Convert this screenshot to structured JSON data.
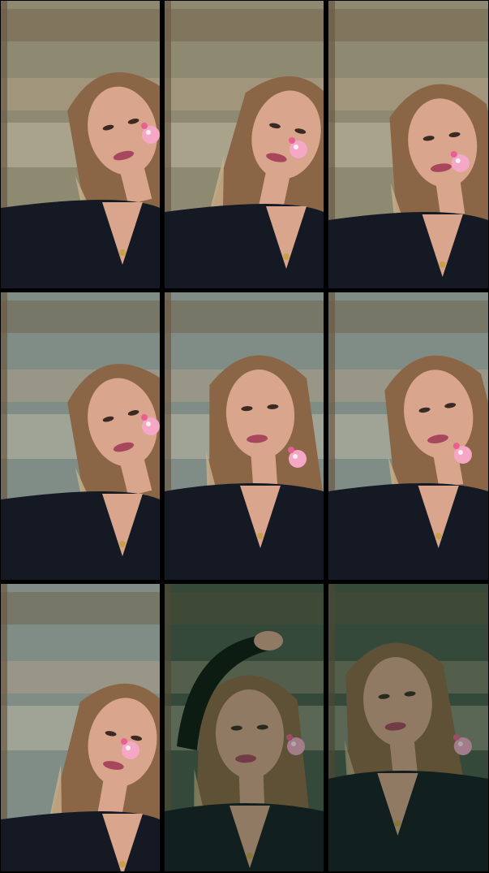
{
  "collage": {
    "layout": "3x3 grid",
    "tiles": [
      {
        "id": "t1",
        "pose": "head-tilt-left",
        "filter": "pink-nose-sticker",
        "tone": "warm"
      },
      {
        "id": "t2",
        "pose": "head-tilt-right",
        "filter": "pink-nose-sticker",
        "tone": "warm"
      },
      {
        "id": "t3",
        "pose": "head-tilt-left-blur",
        "filter": "pink-nose-sticker",
        "tone": "warm"
      },
      {
        "id": "t4",
        "pose": "head-tilt-left",
        "filter": "pink-nose-sticker",
        "tone": "cool"
      },
      {
        "id": "t5",
        "pose": "front",
        "filter": "pink-nose-sticker",
        "tone": "cool"
      },
      {
        "id": "t6",
        "pose": "eyes-closed",
        "filter": "pink-nose-sticker",
        "tone": "cool"
      },
      {
        "id": "t7",
        "pose": "lean-right-blur",
        "filter": "pink-nose-sticker",
        "tone": "cool"
      },
      {
        "id": "t8",
        "pose": "arm-raised",
        "filter": "pink-nose-sticker",
        "tone": "green-dark"
      },
      {
        "id": "t9",
        "pose": "smiling",
        "filter": "pink-nose-sticker",
        "tone": "green-dark"
      }
    ]
  },
  "colors": {
    "background": "#000000",
    "hair": "#8a6646",
    "hair_light": "#c9b08a",
    "skin": "#d9a58c",
    "top": "#141923",
    "wall_warm": "#8e8a72",
    "wall_cool": "#7f8d86",
    "wall_dark": "#4b5a4c",
    "sticker": "#f4a8c6"
  }
}
